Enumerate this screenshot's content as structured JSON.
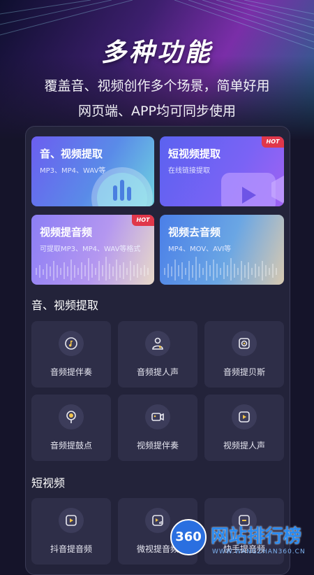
{
  "hero": {
    "title": "多种功能",
    "line1": "覆盖音、视频创作多个场景，简单好用",
    "line2": "网页端、APP均可同步使用"
  },
  "feature_cards": [
    {
      "title": "音、视频提取",
      "subtitle": "MP3、MP4、WAV等",
      "hot": ""
    },
    {
      "title": "短视频提取",
      "subtitle": "在线链接提取",
      "hot": "HOT"
    },
    {
      "title": "视频提音频",
      "subtitle": "可提取MP3、MP4、WAV等格式",
      "hot": "HOT"
    },
    {
      "title": "视频去音频",
      "subtitle": "MP4、MOV、AVI等",
      "hot": ""
    }
  ],
  "section1": {
    "title": "音、视频提取",
    "items": [
      {
        "label": "音频提伴奏",
        "icon": "music-note-icon"
      },
      {
        "label": "音频提人声",
        "icon": "person-voice-icon"
      },
      {
        "label": "音频提贝斯",
        "icon": "speaker-icon"
      },
      {
        "label": "音频提鼓点",
        "icon": "drum-icon"
      },
      {
        "label": "视频提伴奏",
        "icon": "video-camera-icon"
      },
      {
        "label": "视频提人声",
        "icon": "video-play-icon"
      }
    ]
  },
  "section2": {
    "title": "短视频",
    "items": [
      {
        "label": "抖音提音频",
        "icon": "play-box-icon"
      },
      {
        "label": "微视提音频",
        "icon": "play-audio-icon"
      },
      {
        "label": "快手提音频",
        "icon": "link-icon"
      }
    ]
  },
  "watermark": {
    "logo": "360",
    "name": "网站排行榜",
    "url": "WWW.WANGZHAN360.CN"
  },
  "colors": {
    "background": "#15142a",
    "panel": "#23233a",
    "tile": "#2e2e48",
    "hot": "#e0374a"
  }
}
